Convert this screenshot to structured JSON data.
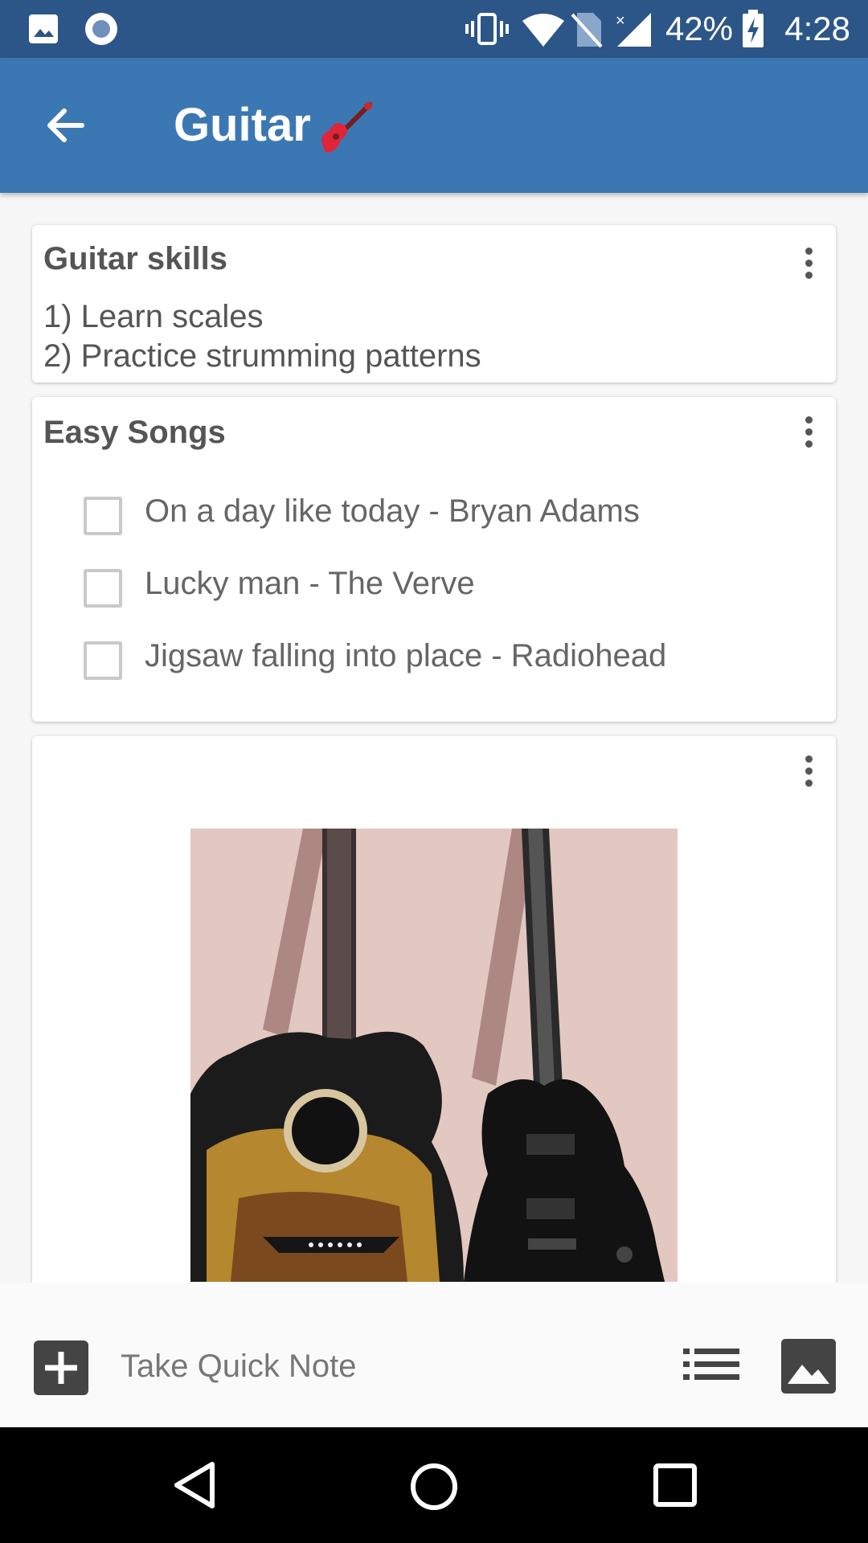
{
  "status_bar": {
    "battery_percent": "42%",
    "time": "4:28",
    "icons": [
      "image-icon",
      "circle-icon",
      "vibrate-icon",
      "wifi-icon",
      "no-sim-icon",
      "signal-icon",
      "battery-charging-icon"
    ]
  },
  "app_bar": {
    "title": "Guitar",
    "back_icon": "arrow-left-icon",
    "title_emoji": "guitar-emoji-icon"
  },
  "notes": [
    {
      "title": "Guitar skills",
      "body_lines": [
        "1) Learn scales",
        "2) Practice strumming patterns"
      ]
    },
    {
      "title": "Easy Songs",
      "items": [
        {
          "label": "On a day like today - Bryan Adams",
          "checked": false
        },
        {
          "label": "Lucky man - The Verve",
          "checked": false
        },
        {
          "label": "Jigsaw falling into place - Radiohead",
          "checked": false
        }
      ]
    },
    {
      "type": "image",
      "image_subject": "acoustic-and-electric-guitar-photo"
    }
  ],
  "bottom_bar": {
    "placeholder": "Take Quick Note",
    "icons": [
      "add-icon",
      "list-icon",
      "image-icon"
    ]
  },
  "colors": {
    "status_bar": "#2c5688",
    "app_bar": "#3b78b3",
    "card_text": "#555555"
  }
}
